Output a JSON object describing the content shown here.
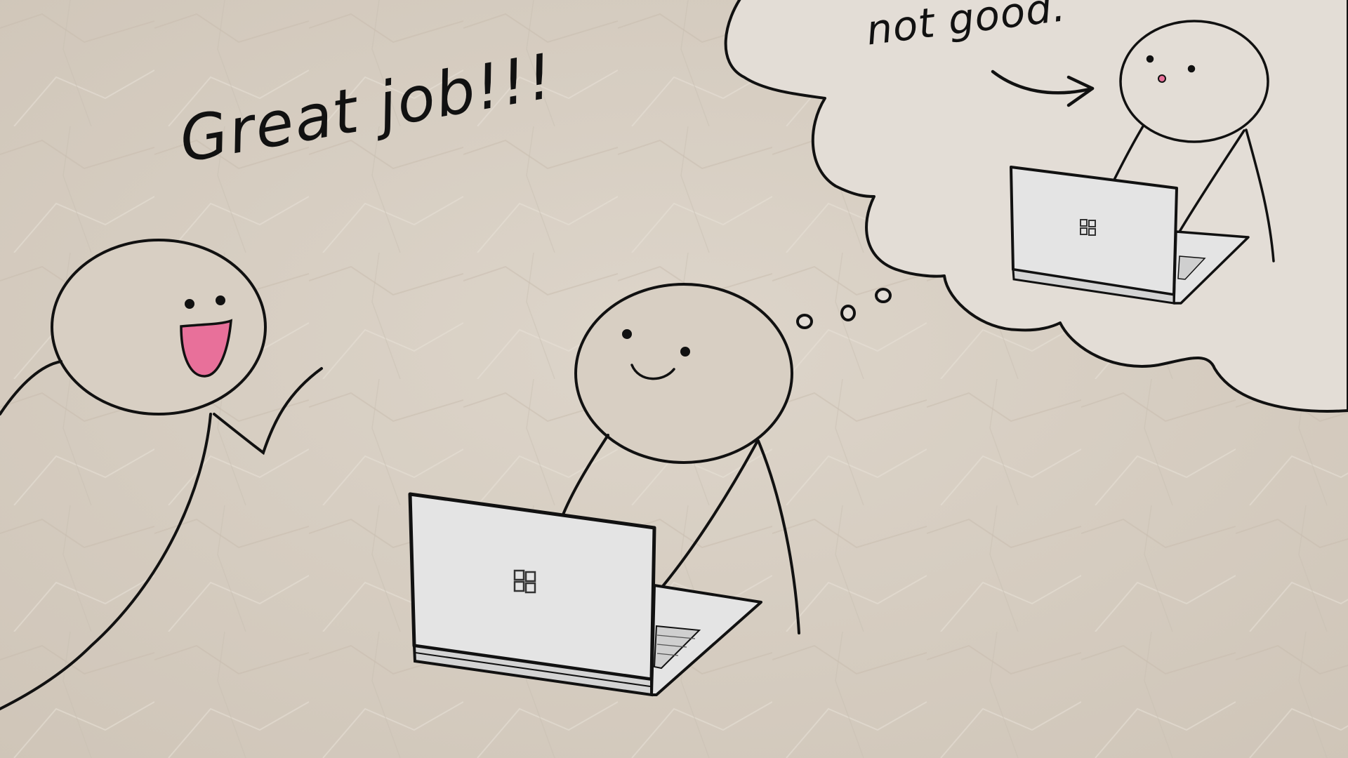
{
  "captions": {
    "praise": "Great job!!!",
    "thought": "not good."
  },
  "colors": {
    "paper": "#d8cfc3",
    "ink": "#111111",
    "cloud": "#e3ddd6",
    "laptop": "#e4e4e4",
    "mouth_pink": "#e8709a"
  },
  "icons": {
    "laptop_logo": "windows-logo-icon",
    "arrow": "curved-arrow-icon"
  }
}
